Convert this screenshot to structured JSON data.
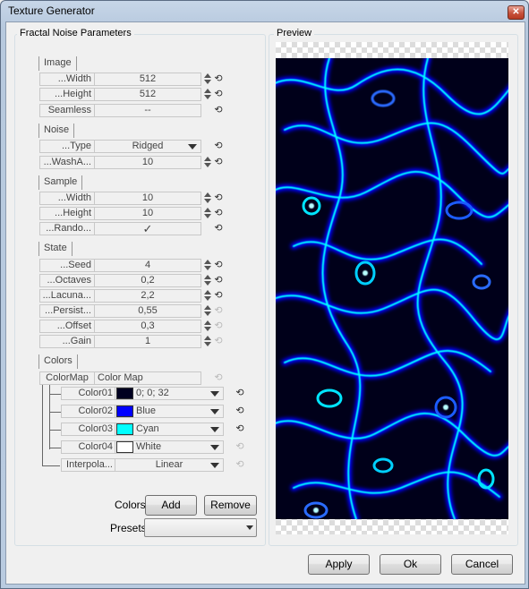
{
  "window": {
    "title": "Texture Generator",
    "close_glyph": "✕"
  },
  "params": {
    "group_title": "Fractal Noise Parameters",
    "sections": {
      "image": "Image",
      "noise": "Noise",
      "sample": "Sample",
      "state": "State",
      "colors": "Colors"
    },
    "image": {
      "width": {
        "label": "...Width",
        "value": "512"
      },
      "height": {
        "label": "...Height",
        "value": "512"
      },
      "seamless": {
        "label": "Seamless",
        "value": "--"
      }
    },
    "noise": {
      "type": {
        "label": "...Type",
        "value": "Ridged"
      },
      "washa": {
        "label": "...WashA...",
        "value": "10"
      }
    },
    "sample": {
      "width": {
        "label": "...Width",
        "value": "10"
      },
      "height": {
        "label": "...Height",
        "value": "10"
      },
      "rando": {
        "label": "...Rando...",
        "value": "✓"
      }
    },
    "state": {
      "seed": {
        "label": "...Seed",
        "value": "4"
      },
      "octaves": {
        "label": "...Octaves",
        "value": "0,2"
      },
      "lacuna": {
        "label": "...Lacuna...",
        "value": "2,2"
      },
      "persist": {
        "label": "...Persist...",
        "value": "0,55"
      },
      "offset": {
        "label": "...Offset",
        "value": "0,3"
      },
      "gain": {
        "label": "...Gain",
        "value": "1"
      }
    },
    "colors": {
      "colormap": {
        "label": "ColorMap",
        "value": "Color Map"
      },
      "entries": [
        {
          "label": "Color01",
          "value": "0; 0; 32",
          "swatch": "#000020"
        },
        {
          "label": "Color02",
          "value": "Blue",
          "swatch": "#0000ff"
        },
        {
          "label": "Color03",
          "value": "Cyan",
          "swatch": "#00ffff"
        },
        {
          "label": "Color04",
          "value": "White",
          "swatch": "#ffffff"
        }
      ],
      "interpolation": {
        "label": "Interpola...",
        "value": "Linear"
      }
    },
    "reset_glyph": "⟲",
    "buttons": {
      "colors_label": "Colors",
      "add": "Add",
      "remove": "Remove",
      "presets_label": "Presets",
      "presets_value": ""
    }
  },
  "preview": {
    "title": "Preview"
  },
  "footer": {
    "apply": "Apply",
    "ok": "Ok",
    "cancel": "Cancel"
  },
  "colors": {
    "texture_dark": "#00001a",
    "texture_blue": "#0000ff",
    "texture_cyan": "#00ffff"
  }
}
